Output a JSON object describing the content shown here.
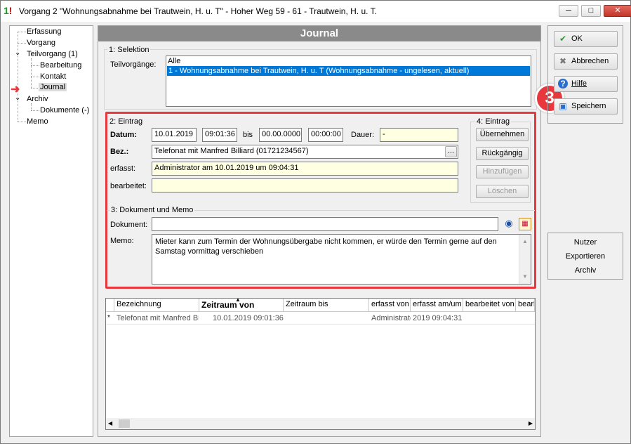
{
  "window": {
    "title": "Vorgang 2 \"Wohnungsabnahme bei Trautwein, H. u. T\" - Hoher Weg 59 - 61 - Trautwein, H. u. T.",
    "minimize": "─",
    "maximize": "□",
    "close": "✕"
  },
  "tree": {
    "items": [
      {
        "label": "Erfassung"
      },
      {
        "label": "Vorgang"
      },
      {
        "label": "Teilvorgang (1)"
      },
      {
        "label": "Bearbeitung"
      },
      {
        "label": "Kontakt"
      },
      {
        "label": "Journal"
      },
      {
        "label": "Archiv"
      },
      {
        "label": "Dokumente (-)"
      },
      {
        "label": "Memo"
      }
    ]
  },
  "header": {
    "title": "Journal"
  },
  "selektion": {
    "group_label": "1: Selektion",
    "teilvorgaenge_label": "Teilvorgänge:",
    "list": [
      "Alle",
      "1 - Wohnungsabnahme bei Trautwein, H. u. T (Wohnungsabnahme - ungelesen, aktuell)"
    ]
  },
  "eintrag": {
    "group_label": "2: Eintrag",
    "datum_label": "Datum:",
    "datum_date": "10.01.2019",
    "datum_time": "09:01:36",
    "bis_label": "bis",
    "bis_date": "00.00.0000",
    "bis_time": "00:00:00",
    "dauer_label": "Dauer:",
    "dauer_value": "-",
    "bez_label": "Bez.:",
    "bez_value": "Telefonat mit Manfred Billiard (01721234567)",
    "bez_button": "...",
    "erfasst_label": "erfasst:",
    "erfasst_value": "Administrator am 10.01.2019 um 09:04:31",
    "bearbeitet_label": "bearbeitet:",
    "bearbeitet_value": ""
  },
  "eintrag_actions": {
    "group_label": "4: Eintrag",
    "uebernehmen": "Übernehmen",
    "rueckgaengig": "Rückgängig",
    "hinzufuegen": "Hinzufügen",
    "loeschen": "Löschen"
  },
  "dokument": {
    "group_label": "3: Dokument und Memo",
    "dokument_label": "Dokument:",
    "dokument_value": "",
    "memo_label": "Memo:",
    "memo_value": "Mieter kann zum Termin der Wohnungsübergabe nicht kommen, er würde den Termin gerne auf den Samstag vormittag verschieben"
  },
  "annotation": {
    "badge": "3",
    "color": "#e8383d"
  },
  "grid": {
    "columns": [
      "Bezeichnung",
      "Zeitraum von",
      "Zeitraum bis",
      "erfasst von",
      "erfasst am/um",
      "bearbeitet von",
      "bearb"
    ],
    "rows": [
      [
        "*",
        "Telefonat mit Manfred Bil",
        "10.01.2019 09:01:36",
        "",
        "Administrato",
        "2019 09:04:31",
        "",
        ""
      ]
    ]
  },
  "right_panel": {
    "ok": "OK",
    "abbrechen": "Abbrechen",
    "hilfe": "Hilfe",
    "speichern": "Speichern",
    "nutzer": "Nutzer",
    "exportieren": "Exportieren",
    "archiv": "Archiv"
  }
}
